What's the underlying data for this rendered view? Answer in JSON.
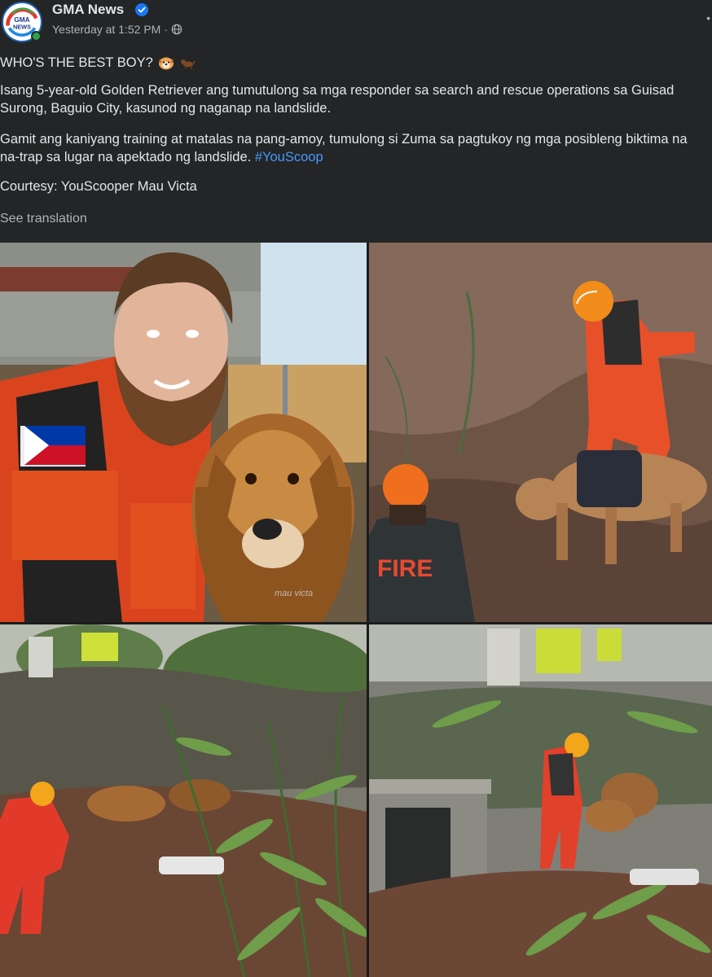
{
  "post": {
    "page_name": "GMA News",
    "timestamp": "Yesterday at 1:52 PM",
    "separator": "·",
    "avatar_logo_text": "GMA NEWS",
    "headline": "WHO'S THE BEST BOY?",
    "paragraph_1": "Isang 5-year-old Golden Retriever ang tumutulong sa mga responder sa search and rescue operations sa Guisad Surong, Baguio City, kasunod ng naganap na landslide.",
    "paragraph_2_text": "Gamit ang kaniyang training at matalas na pang-amoy, tumulong si Zuma sa pagtukoy ng mga posibleng biktima na na-trap sa lugar na apektado ng landslide.",
    "paragraph_2_hashtag": "#YouScoop",
    "courtesy": "Courtesy: YouScooper Mau Victa",
    "see_translation": "See translation"
  },
  "photos": [
    {
      "alt": "man-with-golden-retriever",
      "watermark": "mau victa"
    },
    {
      "alt": "rescuer-and-dog-on-landslide"
    },
    {
      "alt": "dog-and-rescuer-in-bamboo"
    },
    {
      "alt": "rescuer-and-dog-near-house"
    }
  ],
  "icons": {
    "verified": "verified-badge-icon",
    "globe": "globe-icon",
    "more": "more-options-icon",
    "emoji_1": "dog-face-emoji",
    "emoji_2": "dog-emoji"
  },
  "colors": {
    "background": "#242526",
    "text": "#e4e6eb",
    "secondary_text": "#b0b3b8",
    "link": "#4599ff",
    "verified": "#1877f2",
    "online": "#31a24c"
  }
}
